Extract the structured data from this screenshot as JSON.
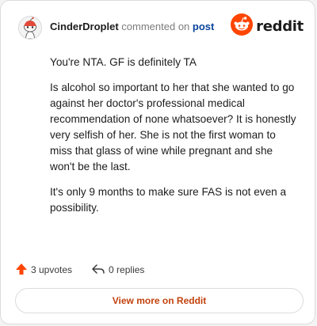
{
  "header": {
    "username": "CinderDroplet",
    "action": "commented on",
    "post_link": "post",
    "brand": "reddit",
    "avatar_icon": "snoo-avatar-icon",
    "brand_icon": "reddit-logo-icon"
  },
  "comment": {
    "paragraphs": [
      "You're NTA. GF is definitely TA",
      "Is alcohol so important to her that she wanted to go against her doctor's professional medical recommendation of none whatsoever? It is honestly very selfish of her. She is not the first woman to miss that glass of wine while pregnant and she won't be the last.",
      "It's only 9 months to make sure FAS is not even a possibility."
    ]
  },
  "footer": {
    "upvotes_label": "3 upvotes",
    "replies_label": "0 replies",
    "upvote_icon": "upvote-arrow-icon",
    "reply_icon": "reply-arrow-icon",
    "view_more_label": "View more on Reddit"
  },
  "colors": {
    "accent": "#ff4500",
    "link": "#0a449b",
    "view_more_text": "#c2410c"
  }
}
